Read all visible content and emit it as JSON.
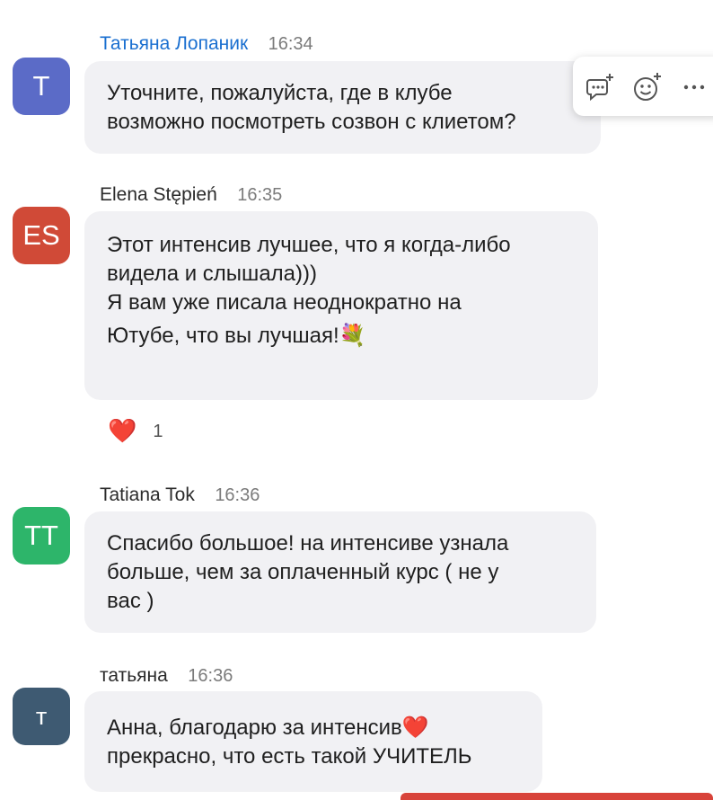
{
  "messages": [
    {
      "avatar_initials": "T",
      "avatar_color": "#5b6bc7",
      "name": "Татьяна Лопаник",
      "time": "16:34",
      "lines": [
        "Уточните, пожалуйста, где в клубе",
        "возможно посмотреть созвон с клиетом?"
      ]
    },
    {
      "avatar_initials": "ES",
      "avatar_color": "#d04a37",
      "name": "Elena Stępień",
      "time": "16:35",
      "lines": [
        "Этот интенсив лучшее, что я когда-либо",
        "видела и слышала)))",
        "Я вам уже писала неоднократно на",
        "Ютубе, что вы лучшая!"
      ],
      "line4_emoji": "💐",
      "reaction": {
        "emoji": "❤️",
        "count": "1"
      }
    },
    {
      "avatar_initials": "TT",
      "avatar_color": "#2db56a",
      "name": "Tatiana Tok",
      "time": "16:36",
      "lines": [
        "Спасибо большое!  на интенсиве узнала",
        "больше, чем за оплаченный курс ( не у",
        "вас )"
      ]
    },
    {
      "avatar_initials": "т",
      "avatar_color": "#3e5a72",
      "name": "татьяна",
      "time": "16:36",
      "lines": [
        "Анна, благодарю за интенсив",
        "прекрасно, что есть такой УЧИТЕЛЬ"
      ],
      "line1_emoji": "❤️"
    }
  ],
  "hover_toolbar": {
    "icons": [
      "reply-in-thread-icon",
      "add-reaction-icon",
      "more-options-icon"
    ]
  },
  "colors": {
    "highlight_name": "#1a6fd0",
    "bubble_bg": "#f1f1f4"
  }
}
